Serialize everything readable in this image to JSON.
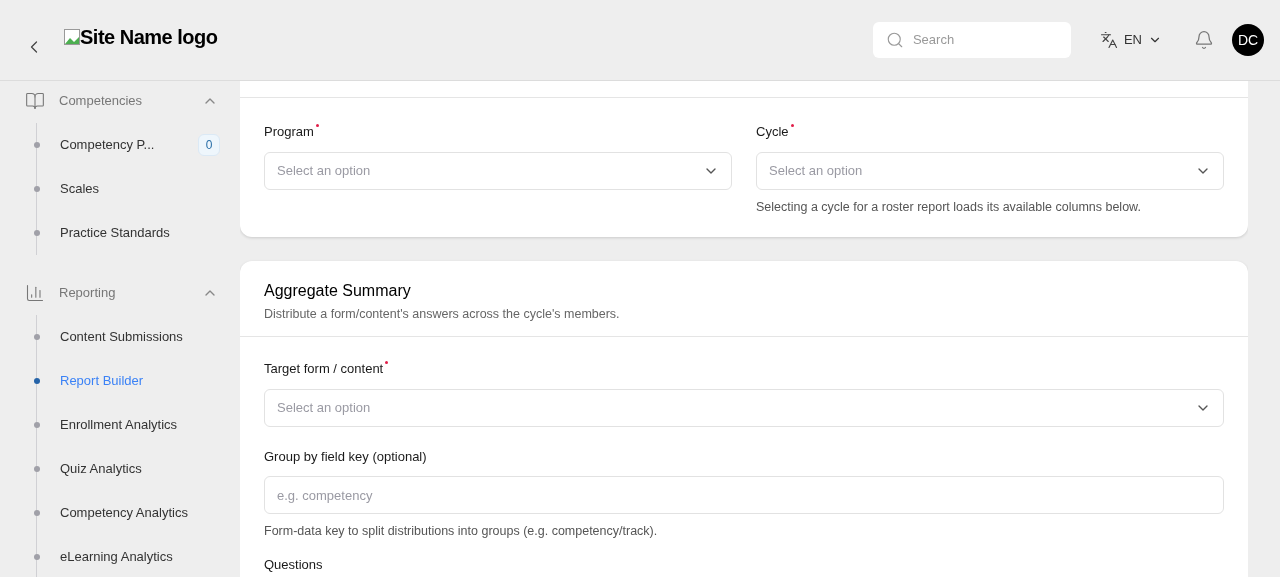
{
  "header": {
    "logo_alt": "Site Name logo",
    "search": {
      "placeholder": "Search"
    },
    "language": "EN",
    "avatar": "DC"
  },
  "sidebar": {
    "groups": [
      {
        "label": "Competencies",
        "kind": "book",
        "expanded": true,
        "items": [
          {
            "label": "Competency P...",
            "badge": "0",
            "selected": false
          },
          {
            "label": "Scales",
            "selected": false
          },
          {
            "label": "Practice Standards",
            "selected": false
          }
        ]
      },
      {
        "label": "Reporting",
        "kind": "chart",
        "expanded": true,
        "items": [
          {
            "label": "Content Submissions",
            "selected": false
          },
          {
            "label": "Report Builder",
            "selected": true
          },
          {
            "label": "Enrollment Analytics",
            "selected": false
          },
          {
            "label": "Quiz Analytics",
            "selected": false
          },
          {
            "label": "Competency Analytics",
            "selected": false
          },
          {
            "label": "eLearning Analytics",
            "selected": false
          }
        ]
      }
    ]
  },
  "report_card": {
    "fields": [
      {
        "label": "Program",
        "required": true,
        "placeholder": "Select an option"
      },
      {
        "label": "Cycle",
        "required": true,
        "placeholder": "Select an option",
        "help": "Selecting a cycle for a roster report loads its available columns below."
      }
    ]
  },
  "aggregate_card": {
    "title": "Aggregate Summary",
    "subtitle": "Distribute a form/content's answers across the cycle's members.",
    "fields": [
      {
        "kind": "select",
        "label": "Target form / content",
        "required": true,
        "placeholder": "Select an option"
      },
      {
        "kind": "text",
        "label": "Group by field key (optional)",
        "placeholder": "e.g. competency",
        "help": "Form-data key to split distributions into groups (e.g. competency/track)."
      },
      {
        "kind": "heading",
        "label": "Questions"
      }
    ]
  }
}
